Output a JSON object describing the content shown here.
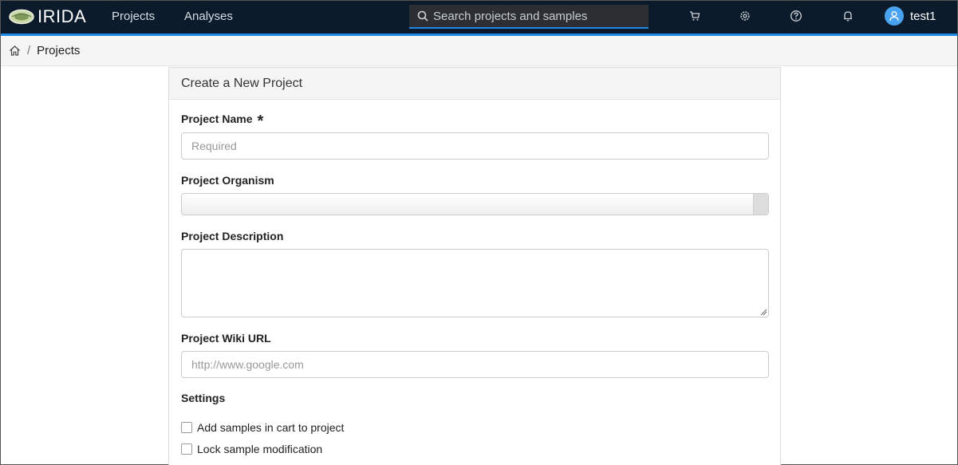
{
  "nav": {
    "brand": "IRIDA",
    "links": [
      "Projects",
      "Analyses"
    ],
    "search_placeholder": "Search projects and samples",
    "icons": [
      "cart-icon",
      "gear-icon",
      "help-icon",
      "bell-icon"
    ],
    "username": "test1",
    "accent": "#1e88e5",
    "background": "#0b1b2b"
  },
  "breadcrumb": {
    "home_icon": "home-icon",
    "separator": "/",
    "current": "Projects"
  },
  "form": {
    "title": "Create a New Project",
    "name_label": "Project Name",
    "name_required_mark": "*",
    "name_placeholder": "Required",
    "organism_label": "Project Organism",
    "description_label": "Project Description",
    "wiki_label": "Project Wiki URL",
    "wiki_placeholder": "http://www.google.com",
    "settings_label": "Settings",
    "settings": [
      {
        "label": "Add samples in cart to project",
        "checked": false
      },
      {
        "label": "Lock sample modification",
        "checked": false
      }
    ]
  }
}
